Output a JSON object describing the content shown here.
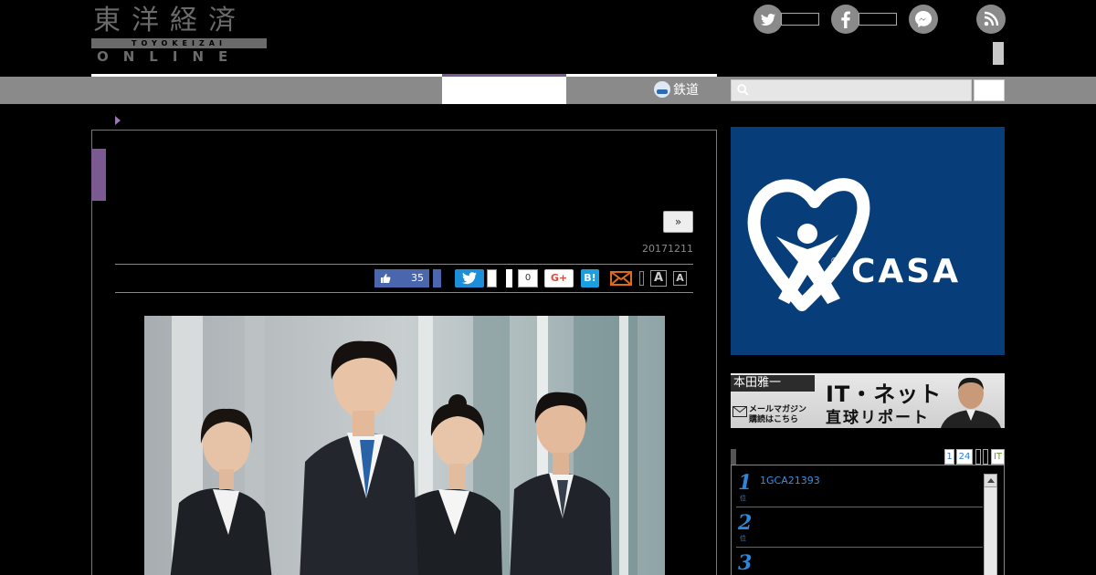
{
  "header": {
    "logo": {
      "kanji": "東洋経済",
      "romaji": "TOYOKEIZAI",
      "online": "ONLINE"
    },
    "social_icons": [
      "twitter-icon",
      "facebook-icon",
      "messenger-icon",
      "rss-icon"
    ]
  },
  "nav": {
    "railway_label": "鉄道",
    "search": {
      "placeholder": ""
    },
    "active_color": "#7a5a90"
  },
  "article": {
    "next_label": "»",
    "date": "20171211",
    "share": {
      "like_count": "35",
      "pocket_count": "0",
      "gplus_label": "G+",
      "hatena_label": "B!",
      "font_large": "A",
      "font_small": "A"
    },
    "photo_icon": "business-people-photo"
  },
  "sidebar": {
    "ad": {
      "brand": "CASA",
      "reg_mark": "®",
      "bg_color": "#073d79"
    },
    "mailmag": {
      "author": "本田雅一",
      "title": "IT・ネット",
      "subtitle": "直球リポート",
      "cta_line1": "メールマガジン",
      "cta_line2": "購読はこちら"
    },
    "ranking": {
      "tabs": [
        "1",
        "24",
        "",
        "",
        "IT"
      ],
      "rows": [
        {
          "num": "1",
          "sub": "位",
          "text": "1GCA21393"
        },
        {
          "num": "2",
          "sub": "位",
          "text": ""
        },
        {
          "num": "3",
          "sub": "位",
          "text": ""
        }
      ]
    }
  }
}
